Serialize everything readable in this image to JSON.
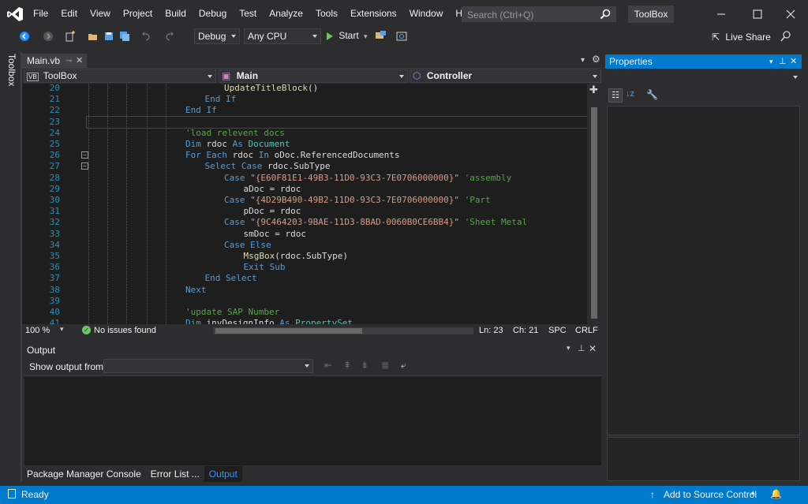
{
  "menu": [
    "File",
    "Edit",
    "View",
    "Project",
    "Build",
    "Debug",
    "Test",
    "Analyze",
    "Tools",
    "Extensions",
    "Window",
    "Help"
  ],
  "search": {
    "placeholder": "Search (Ctrl+Q)"
  },
  "window_title": "ToolBox",
  "toolbar": {
    "config": "Debug",
    "platform": "Any CPU",
    "start_label": "Start",
    "live_share": "Live Share"
  },
  "side_strip": "Toolbox",
  "editor": {
    "tab_name": "Main.vb",
    "nav_project": "ToolBox",
    "nav_class": "Main",
    "nav_member": "Controller",
    "lines": [
      {
        "n": "20",
        "indent": 3,
        "parts": [
          [
            "fn",
            "UpdateTitleBlock"
          ],
          [
            "id",
            "()"
          ]
        ]
      },
      {
        "n": "21",
        "indent": 2,
        "parts": [
          [
            "kw",
            "End If"
          ]
        ]
      },
      {
        "n": "22",
        "indent": 1,
        "parts": [
          [
            "kw",
            "End If"
          ]
        ]
      },
      {
        "n": "23",
        "indent": 1,
        "parts": []
      },
      {
        "n": "24",
        "indent": 1,
        "parts": [
          [
            "cm",
            "'load relevent docs"
          ]
        ]
      },
      {
        "n": "25",
        "indent": 1,
        "parts": [
          [
            "kw",
            "Dim "
          ],
          [
            "id",
            "rdoc "
          ],
          [
            "kw",
            "As "
          ],
          [
            "ty",
            "Document"
          ]
        ]
      },
      {
        "n": "26",
        "indent": 1,
        "parts": [
          [
            "kw",
            "For Each "
          ],
          [
            "id",
            "rdoc "
          ],
          [
            "kw",
            "In "
          ],
          [
            "id",
            "oDoc.ReferencedDocuments"
          ]
        ]
      },
      {
        "n": "27",
        "indent": 2,
        "parts": [
          [
            "kw",
            "Select Case "
          ],
          [
            "id",
            "rdoc.SubType"
          ]
        ]
      },
      {
        "n": "28",
        "indent": 3,
        "parts": [
          [
            "kw",
            "Case "
          ],
          [
            "st",
            "\"{E60F81E1-49B3-11D0-93C3-7E0706000000}\""
          ],
          [
            "cm",
            " 'assembly"
          ]
        ]
      },
      {
        "n": "29",
        "indent": 4,
        "parts": [
          [
            "id",
            "aDoc = rdoc"
          ]
        ]
      },
      {
        "n": "30",
        "indent": 3,
        "parts": [
          [
            "kw",
            "Case "
          ],
          [
            "st",
            "\"{4D29B490-49B2-11D0-93C3-7E0706000000}\""
          ],
          [
            "cm",
            " 'Part"
          ]
        ]
      },
      {
        "n": "31",
        "indent": 4,
        "parts": [
          [
            "id",
            "pDoc = rdoc"
          ]
        ]
      },
      {
        "n": "32",
        "indent": 3,
        "parts": [
          [
            "kw",
            "Case "
          ],
          [
            "st",
            "\"{9C464203-9BAE-11D3-8BAD-0060B0CE6BB4}\""
          ],
          [
            "cm",
            " 'Sheet Metal"
          ]
        ]
      },
      {
        "n": "33",
        "indent": 4,
        "parts": [
          [
            "id",
            "smDoc = rdoc"
          ]
        ]
      },
      {
        "n": "34",
        "indent": 3,
        "parts": [
          [
            "kw",
            "Case Else"
          ]
        ]
      },
      {
        "n": "35",
        "indent": 4,
        "parts": [
          [
            "fn",
            "MsgBox"
          ],
          [
            "id",
            "(rdoc.SubType)"
          ]
        ]
      },
      {
        "n": "36",
        "indent": 4,
        "parts": [
          [
            "kw",
            "Exit Sub"
          ]
        ]
      },
      {
        "n": "37",
        "indent": 2,
        "parts": [
          [
            "kw",
            "End Select"
          ]
        ]
      },
      {
        "n": "38",
        "indent": 1,
        "parts": [
          [
            "kw",
            "Next"
          ]
        ]
      },
      {
        "n": "39",
        "indent": 1,
        "parts": []
      },
      {
        "n": "40",
        "indent": 1,
        "parts": [
          [
            "cm",
            "'update SAP Number"
          ]
        ]
      },
      {
        "n": "41",
        "indent": 1,
        "parts": [
          [
            "kw",
            "Dim "
          ],
          [
            "id",
            "invDesignInfo "
          ],
          [
            "kw",
            "As "
          ],
          [
            "ty",
            "PropertySet"
          ]
        ]
      }
    ],
    "zoom": "100 %",
    "issues": "No issues found",
    "ln": "Ln: 23",
    "ch": "Ch: 21",
    "spc": "SPC",
    "crlf": "CRLF"
  },
  "output": {
    "title": "Output",
    "show_from_label": "Show output from:",
    "tabs": [
      "Package Manager Console",
      "Error List ...",
      "Output"
    ]
  },
  "properties": {
    "title": "Properties"
  },
  "statusbar": {
    "ready": "Ready",
    "source_control": "Add to Source Control"
  },
  "colors": {
    "accent": "#007acc",
    "background": "#2d2d30",
    "editor": "#1e1e1e"
  }
}
